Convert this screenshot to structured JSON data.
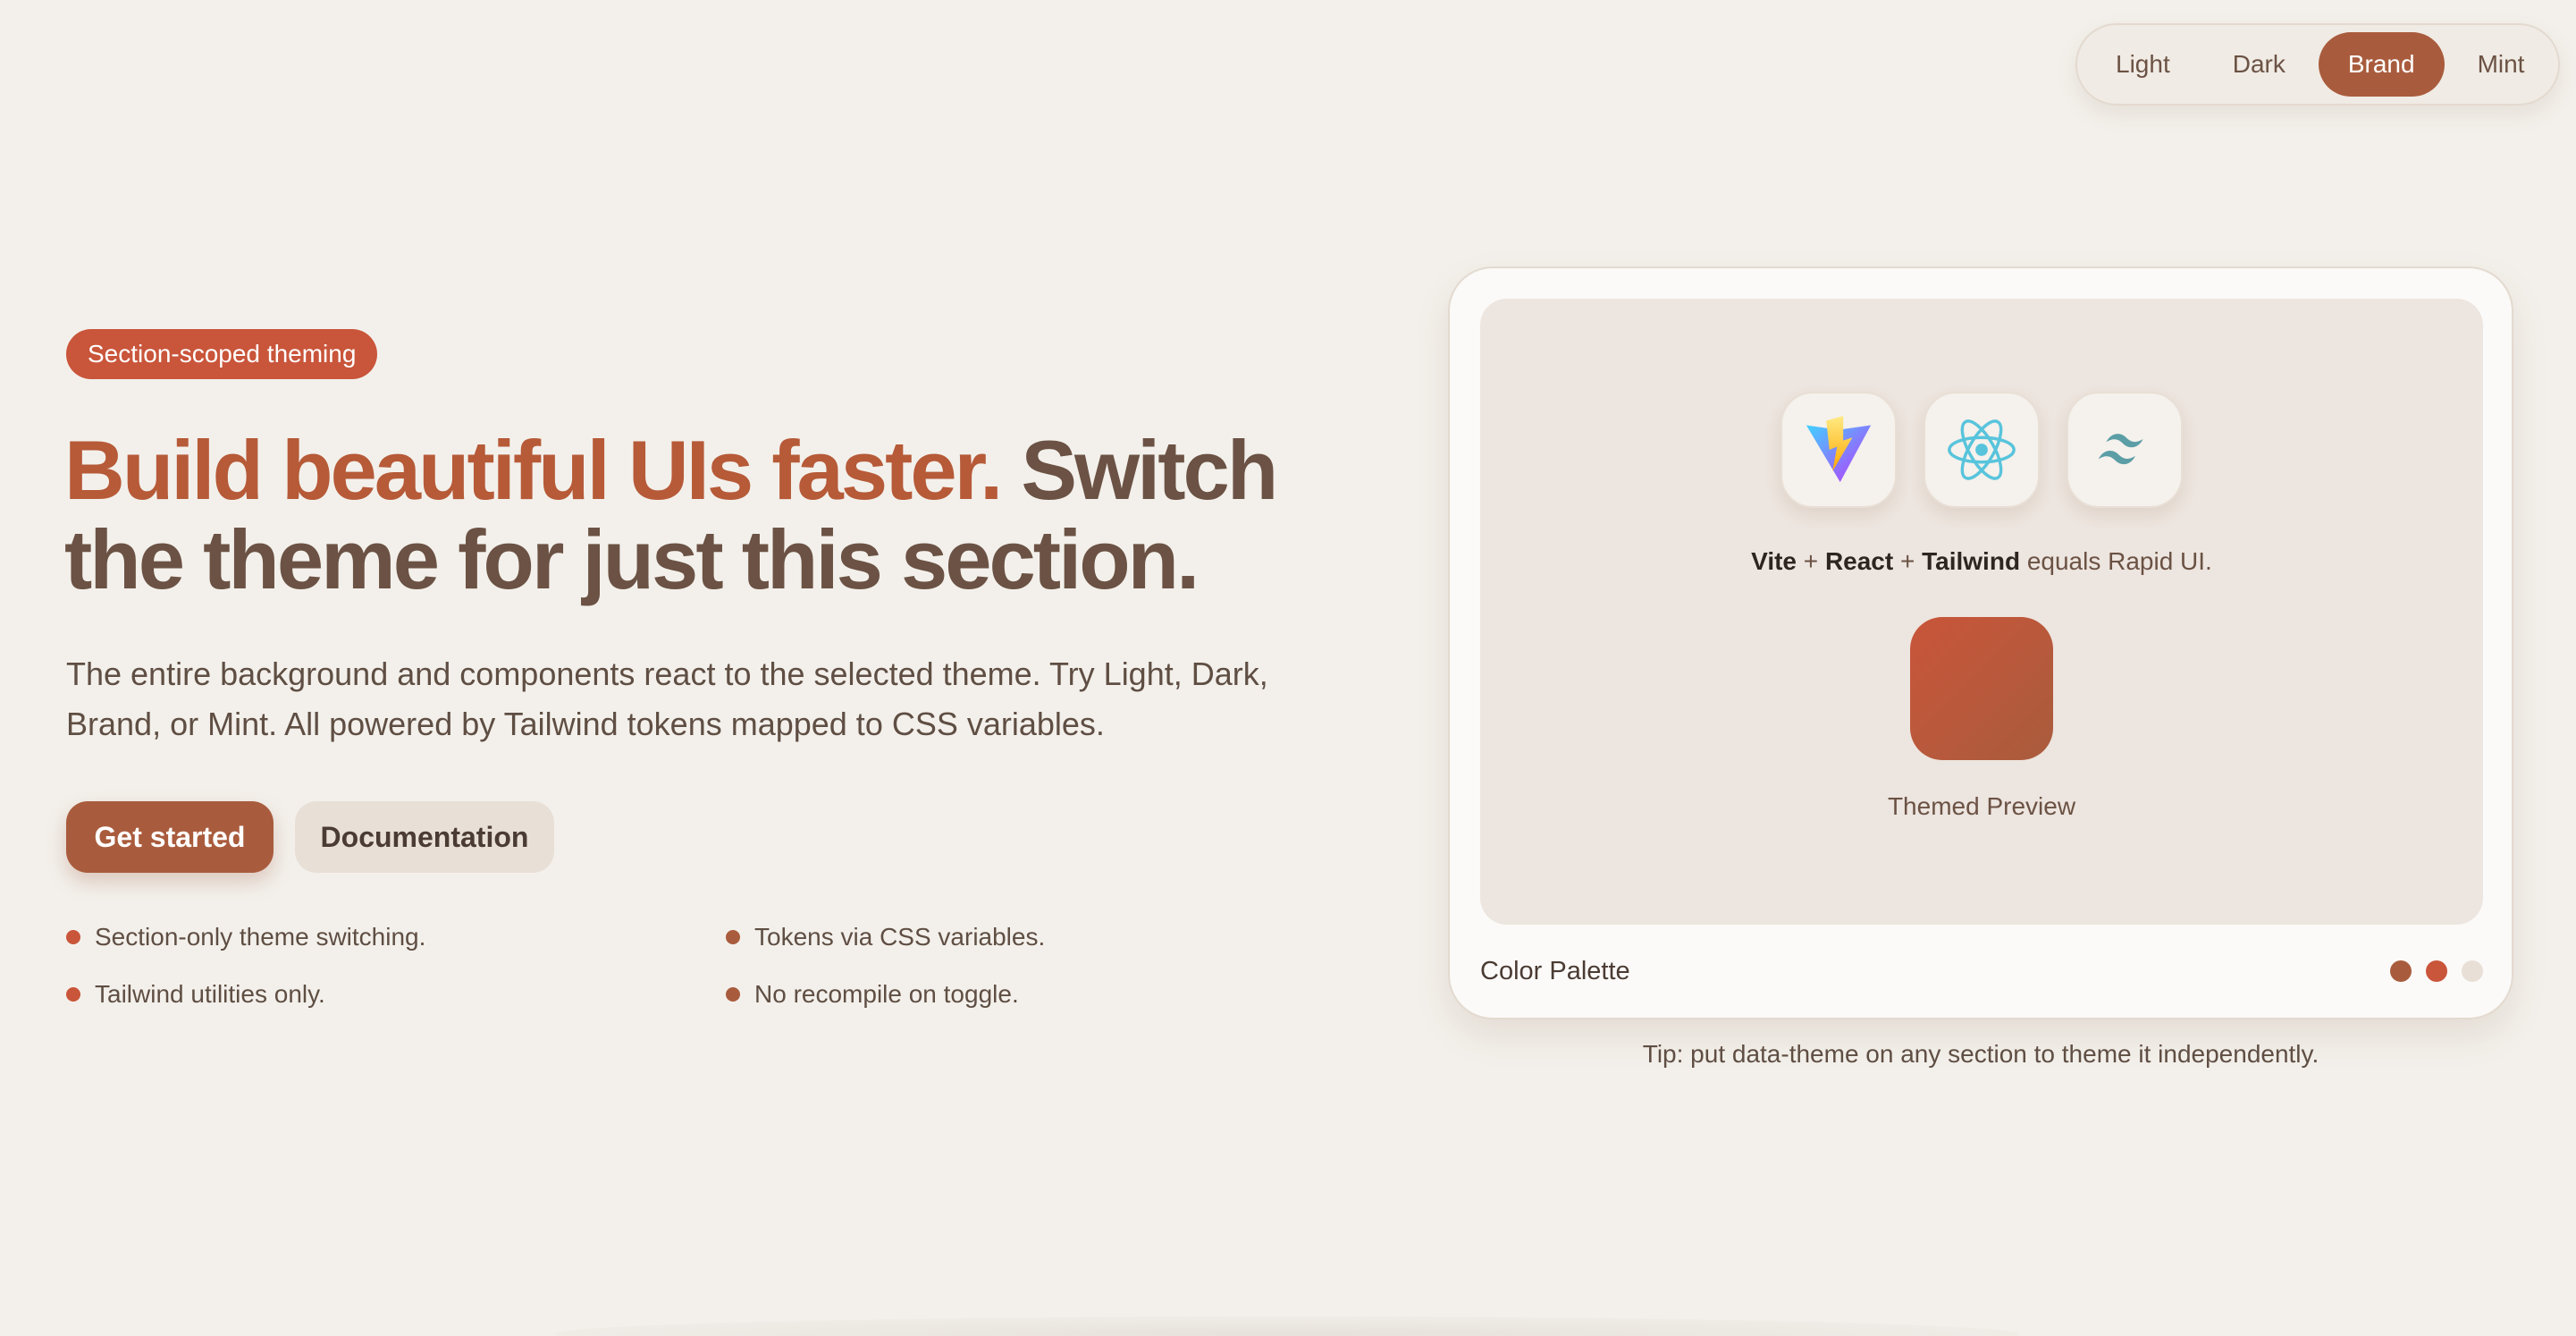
{
  "theme_switcher": {
    "options": [
      "Light",
      "Dark",
      "Brand",
      "Mint"
    ],
    "selected": "Brand"
  },
  "hero": {
    "badge": "Section-scoped theming",
    "headline_accent": "Build beautiful UIs faster.",
    "headline_rest_line1": "Switch",
    "headline_rest_line2": "the theme for just this section.",
    "description": "The entire background and components react to the selected theme. Try Light, Dark, Brand, or Mint. All powered by Tailwind tokens mapped to CSS variables.",
    "primary_button": "Get started",
    "secondary_button": "Documentation",
    "features": [
      "Section-only theme switching.",
      "Tokens via CSS variables.",
      "Tailwind utilities only.",
      "No recompile on toggle."
    ]
  },
  "preview_card": {
    "logos": [
      "vite-logo-icon",
      "react-logo-icon",
      "tailwind-logo-icon"
    ],
    "tagline": {
      "vite": "Vite",
      "plus1": "+",
      "react": "React",
      "plus2": "+",
      "tailwind": "Tailwind",
      "suffix": "equals Rapid UI."
    },
    "swatch_label": "Themed Preview",
    "palette_label": "Color Palette",
    "palette_colors": [
      "#a95c3d",
      "#c9553a",
      "#e8dfd6"
    ]
  },
  "tip": "Tip: put data-theme on any section to theme it independently.",
  "colors": {
    "background": "#f3f0eb",
    "accent": "#a95c3d",
    "accent_strong": "#c9553a",
    "heading": "#6b5244",
    "text": "#5f4e43"
  }
}
